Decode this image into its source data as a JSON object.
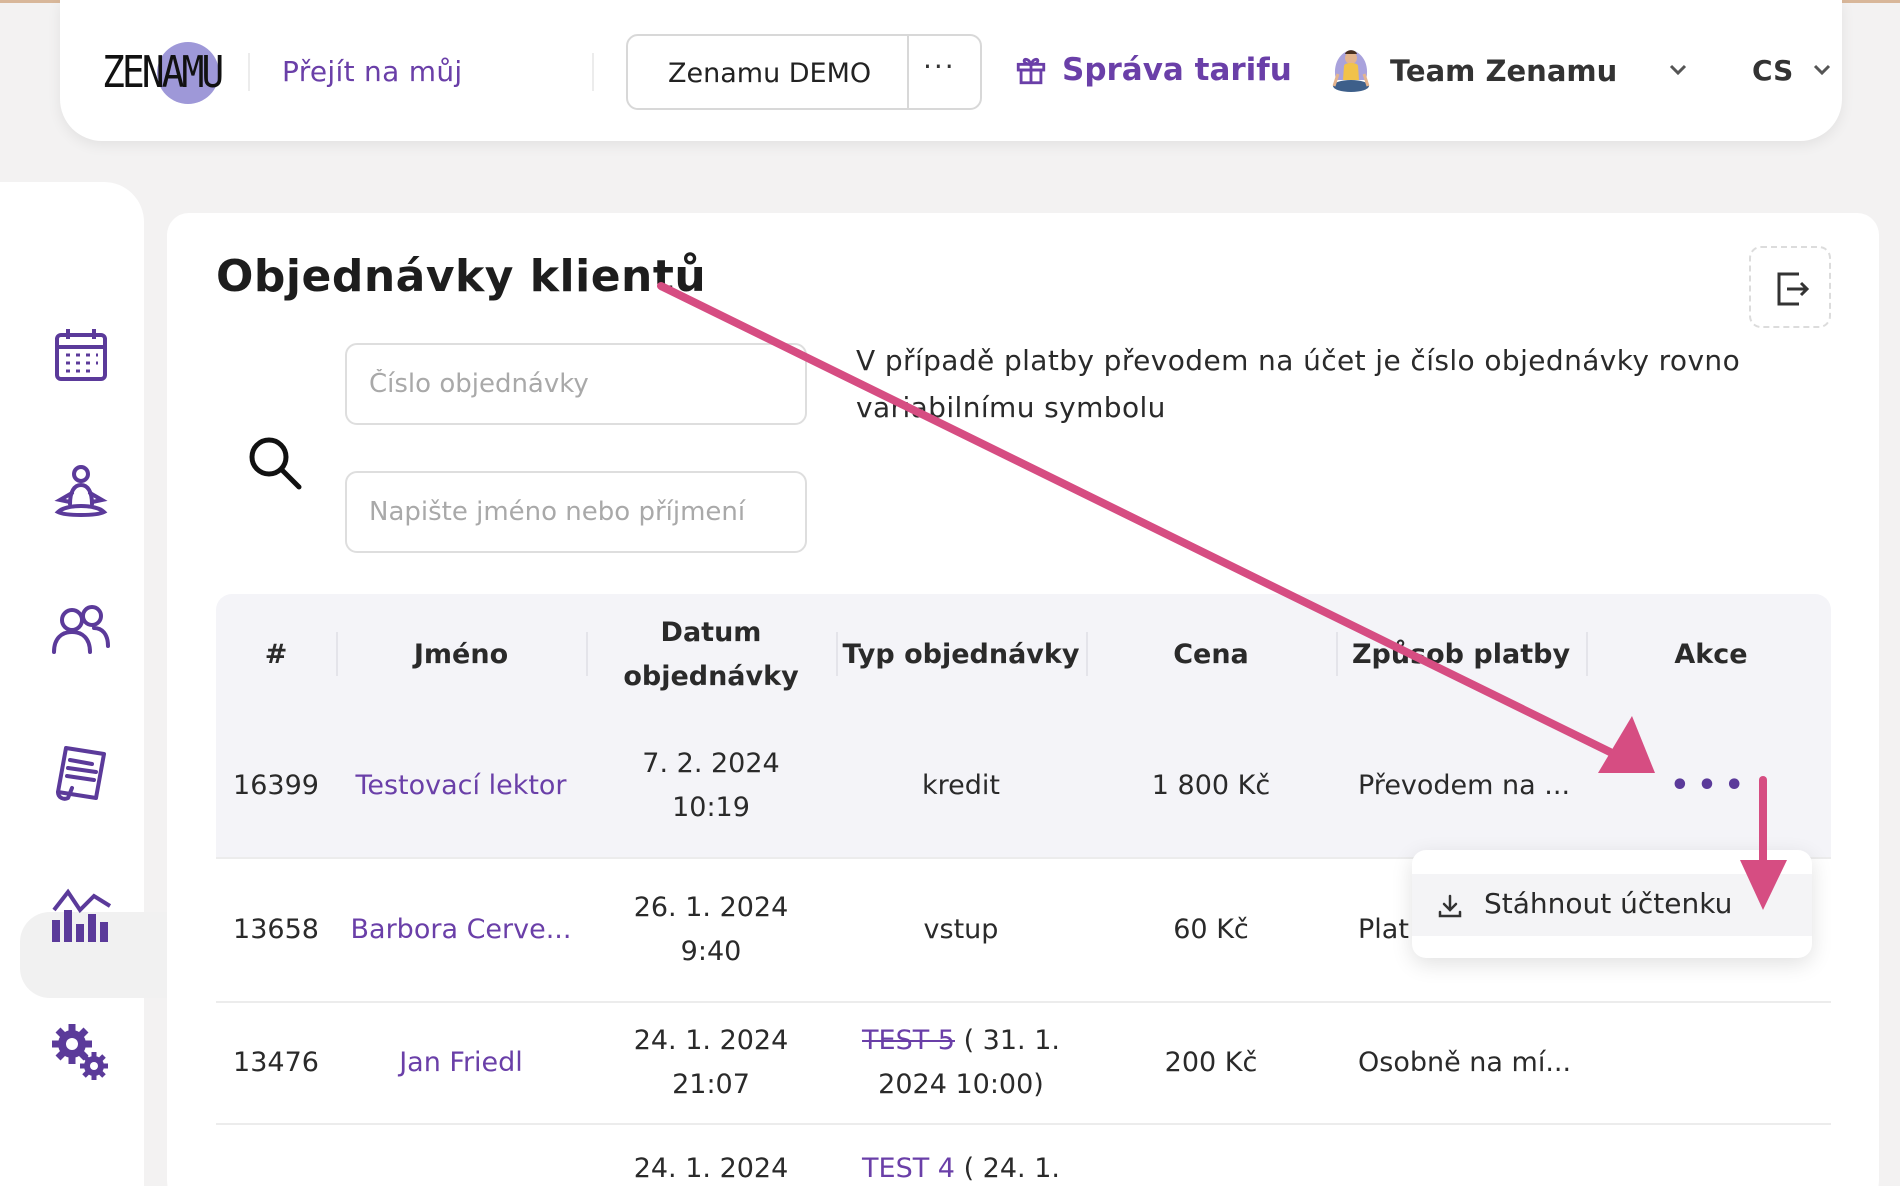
{
  "header": {
    "logo_text": "ZENAMU",
    "goto_link": "Přejít na můj",
    "demo_label": "Zenamu DEMO",
    "demo_more": "···",
    "tariff_label": "Správa tarifu",
    "team_label": "Team Zenamu",
    "lang_label": "CS"
  },
  "sidebar": {
    "items": [
      {
        "icon": "calendar-icon"
      },
      {
        "icon": "meditation-icon"
      },
      {
        "icon": "users-icon"
      },
      {
        "icon": "orders-icon",
        "active": true
      },
      {
        "icon": "stats-icon"
      },
      {
        "icon": "settings-icon"
      }
    ]
  },
  "main": {
    "title": "Objednávky klientů",
    "search": {
      "order_placeholder": "Číslo objednávky",
      "name_placeholder": "Napište jméno nebo příjmení"
    },
    "info": "V případě platby převodem na účet je číslo objednávky rovno variabilnímu symbolu"
  },
  "table": {
    "headers": [
      "#",
      "Jméno",
      "Datum objednávky",
      "Typ objednávky",
      "Cena",
      "Způsob platby",
      "Akce"
    ],
    "rows": [
      {
        "id": "16399",
        "name": "Testovací lektor",
        "date": "7. 2. 2024",
        "time": "10:19",
        "type": "kredit",
        "price": "1 800 Kč",
        "payment": "Převodem na ...",
        "action": "•••"
      },
      {
        "id": "13658",
        "name": "Barbora Cerve...",
        "date": "26. 1. 2024",
        "time": "9:40",
        "type": "vstup",
        "price": "60 Kč",
        "payment": "Plat"
      },
      {
        "id": "13476",
        "name": "Jan Friedl",
        "date": "24. 1. 2024",
        "time": "21:07",
        "type_link": "TEST 5",
        "type_rest": " ( 31. 1. 2024 10:00)",
        "price": "200 Kč",
        "payment": "Osobně na mí..."
      },
      {
        "id": "",
        "name": "",
        "date": "24. 1. 2024",
        "time": "",
        "type_link": "TEST 4",
        "type_rest": " ( 24. 1.",
        "price": "",
        "payment": ""
      }
    ]
  },
  "menu": {
    "download_label": "Stáhnout účtenku"
  },
  "colors": {
    "accent": "#6a3fa8",
    "annotation_arrow": "#d64d82"
  }
}
